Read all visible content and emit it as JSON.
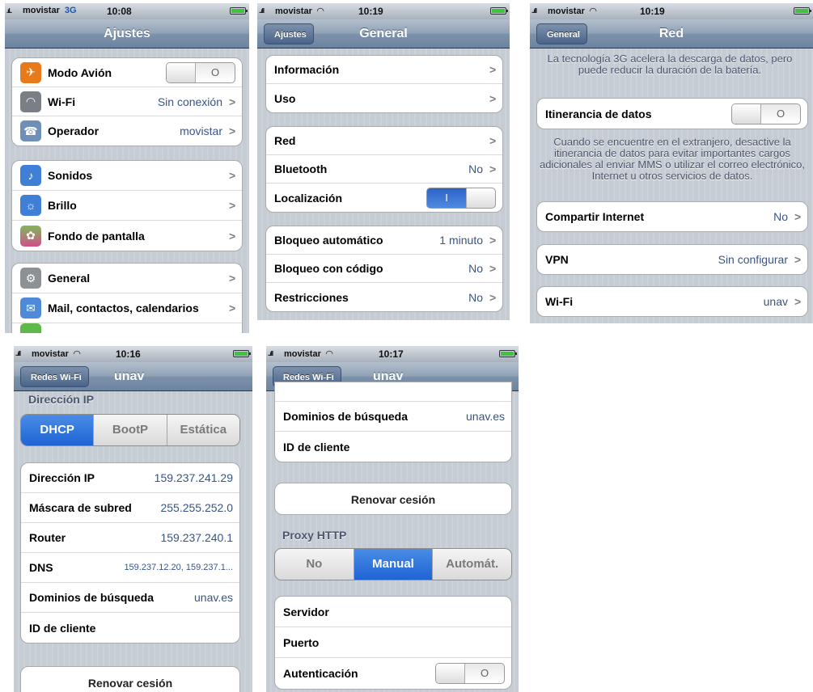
{
  "screen1": {
    "status": {
      "signal": ".ıl..",
      "carrier": "movistar",
      "network": "3G",
      "time": "10:08"
    },
    "title": "Ajustes",
    "group1": [
      {
        "label": "Modo Avión",
        "toggle": "O",
        "icon": "airplane-icon"
      },
      {
        "label": "Wi-Fi",
        "value": "Sin conexión",
        "icon": "wifi-icon"
      },
      {
        "label": "Operador",
        "value": "movistar",
        "icon": "phone-icon"
      }
    ],
    "group2": [
      {
        "label": "Sonidos",
        "icon": "speaker-icon"
      },
      {
        "label": "Brillo",
        "icon": "brightness-icon"
      },
      {
        "label": "Fondo de pantalla",
        "icon": "wallpaper-icon"
      }
    ],
    "group3": [
      {
        "label": "General",
        "icon": "gear-icon"
      },
      {
        "label": "Mail, contactos, calendarios",
        "icon": "mail-icon"
      }
    ]
  },
  "screen2": {
    "status": {
      "signal": "..ıll",
      "carrier": "movistar",
      "time": "10:19"
    },
    "back": "Ajustes",
    "title": "General",
    "group1": [
      {
        "label": "Información"
      },
      {
        "label": "Uso"
      }
    ],
    "group2": [
      {
        "label": "Red"
      },
      {
        "label": "Bluetooth",
        "value": "No"
      },
      {
        "label": "Localización",
        "toggle": "I"
      }
    ],
    "group3": [
      {
        "label": "Bloqueo automático",
        "value": "1 minuto"
      },
      {
        "label": "Bloqueo con código",
        "value": "No"
      },
      {
        "label": "Restricciones",
        "value": "No"
      }
    ]
  },
  "screen3": {
    "status": {
      "signal": "..ıll",
      "carrier": "movistar",
      "time": "10:19"
    },
    "back": "General",
    "title": "Red",
    "note1": "La tecnología 3G acelera la descarga de datos, pero puede reducir la duración de la batería.",
    "roaming": {
      "label": "Itinerancia de datos",
      "toggle": "O"
    },
    "note2": "Cuando se encuentre en el extranjero, desactive la itinerancia de datos para evitar importantes cargos adicionales al enviar MMS o utilizar el correo electrónico, Internet u otros servicios de datos.",
    "tethering": {
      "label": "Compartir Internet",
      "value": "No"
    },
    "vpn": {
      "label": "VPN",
      "value": "Sin configurar"
    },
    "wifi": {
      "label": "Wi-Fi",
      "value": "unav"
    }
  },
  "screen4": {
    "status": {
      "signal": "..ıll",
      "carrier": "movistar",
      "time": "10:16"
    },
    "back": "Redes Wi-Fi",
    "title": "unav",
    "section": "Dirección IP",
    "segments": [
      "DHCP",
      "BootP",
      "Estática"
    ],
    "rows": [
      {
        "label": "Dirección IP",
        "value": "159.237.241.29"
      },
      {
        "label": "Máscara de subred",
        "value": "255.255.252.0"
      },
      {
        "label": "Router",
        "value": "159.237.240.1"
      },
      {
        "label": "DNS",
        "value": "159.237.12.20, 159.237.1..."
      },
      {
        "label": "Dominios de búsqueda",
        "value": "unav.es"
      },
      {
        "label": "ID de cliente"
      }
    ],
    "renew": "Renovar cesión"
  },
  "screen5": {
    "status": {
      "signal": "..ıll",
      "carrier": "movistar",
      "time": "10:17"
    },
    "back": "Redes Wi-Fi",
    "title": "unav",
    "rows": [
      {
        "label": "Dominios de búsqueda",
        "value": "unav.es"
      },
      {
        "label": "ID de cliente"
      }
    ],
    "renew": "Renovar cesión",
    "proxy_header": "Proxy HTTP",
    "segments": [
      "No",
      "Manual",
      "Automát."
    ],
    "proxy_rows": [
      {
        "label": "Servidor"
      },
      {
        "label": "Puerto"
      },
      {
        "label": "Autenticación",
        "toggle": "O"
      }
    ]
  },
  "chevron": ">",
  "colors": {
    "value_blue": "#385487",
    "toggle_on": "#2d63c9",
    "nav_bar": "#6d84a2"
  }
}
